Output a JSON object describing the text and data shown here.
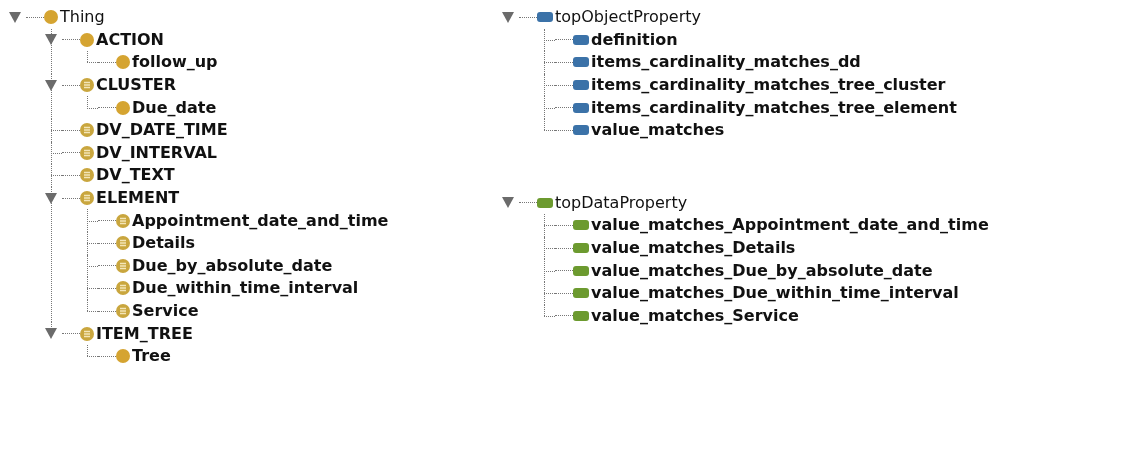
{
  "class_tree": [
    {
      "label": "Thing",
      "kind": "class",
      "bold": false,
      "expanded": true,
      "children": [
        {
          "label": "ACTION",
          "kind": "class",
          "bold": true,
          "expanded": true,
          "children": [
            {
              "label": "follow_up",
              "kind": "class",
              "bold": true
            }
          ]
        },
        {
          "label": "CLUSTER",
          "kind": "defined_class",
          "bold": true,
          "expanded": true,
          "children": [
            {
              "label": "Due_date",
              "kind": "class",
              "bold": true
            }
          ]
        },
        {
          "label": "DV_DATE_TIME",
          "kind": "defined_class",
          "bold": true
        },
        {
          "label": "DV_INTERVAL",
          "kind": "defined_class",
          "bold": true
        },
        {
          "label": "DV_TEXT",
          "kind": "defined_class",
          "bold": true
        },
        {
          "label": "ELEMENT",
          "kind": "defined_class",
          "bold": true,
          "expanded": true,
          "children": [
            {
              "label": "Appointment_date_and_time",
              "kind": "defined_class",
              "bold": true
            },
            {
              "label": "Details",
              "kind": "defined_class",
              "bold": true
            },
            {
              "label": "Due_by_absolute_date",
              "kind": "defined_class",
              "bold": true
            },
            {
              "label": "Due_within_time_interval",
              "kind": "defined_class",
              "bold": true
            },
            {
              "label": "Service",
              "kind": "defined_class",
              "bold": true
            }
          ]
        },
        {
          "label": "ITEM_TREE",
          "kind": "defined_class",
          "bold": true,
          "expanded": true,
          "children": [
            {
              "label": "Tree",
              "kind": "class",
              "bold": true
            }
          ]
        }
      ]
    }
  ],
  "object_property_tree": [
    {
      "label": "topObjectProperty",
      "kind": "object_property",
      "bold": false,
      "expanded": true,
      "children": [
        {
          "label": "definition",
          "kind": "object_property",
          "bold": true
        },
        {
          "label": "items_cardinality_matches_dd",
          "kind": "object_property",
          "bold": true
        },
        {
          "label": "items_cardinality_matches_tree_cluster",
          "kind": "object_property",
          "bold": true
        },
        {
          "label": "items_cardinality_matches_tree_element",
          "kind": "object_property",
          "bold": true
        },
        {
          "label": "value_matches",
          "kind": "object_property",
          "bold": true
        }
      ]
    }
  ],
  "data_property_tree": [
    {
      "label": "topDataProperty",
      "kind": "data_property",
      "bold": false,
      "expanded": true,
      "children": [
        {
          "label": "value_matches_Appointment_date_and_time",
          "kind": "data_property",
          "bold": true
        },
        {
          "label": "value_matches_Details",
          "kind": "data_property",
          "bold": true
        },
        {
          "label": "value_matches_Due_by_absolute_date",
          "kind": "data_property",
          "bold": true
        },
        {
          "label": "value_matches_Due_within_time_interval",
          "kind": "data_property",
          "bold": true
        },
        {
          "label": "value_matches_Service",
          "kind": "data_property",
          "bold": true
        }
      ]
    }
  ]
}
